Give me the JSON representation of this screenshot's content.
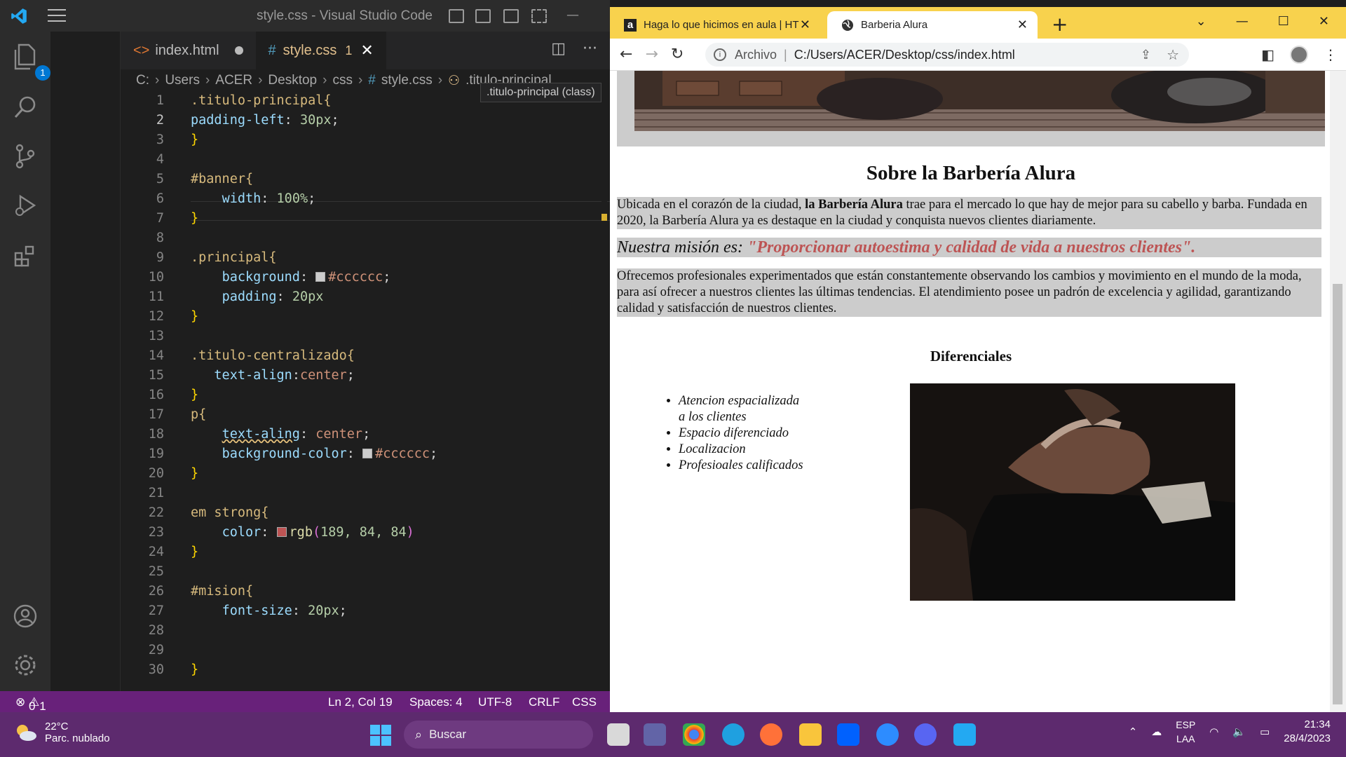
{
  "vscode": {
    "title": "style.css - Visual Studio Code",
    "source_control_badge": "1",
    "tabs": [
      {
        "label": "index.html",
        "modified": true
      },
      {
        "label": "style.css",
        "problems": "1"
      }
    ],
    "breadcrumb": [
      "C:",
      "Users",
      "ACER",
      "Desktop",
      "css",
      "style.css",
      ".titulo-principal"
    ],
    "tooltip": ".titulo-principal (class)",
    "line_numbers": [
      "1",
      "2",
      "3",
      "4",
      "5",
      "6",
      "7",
      "8",
      "9",
      "10",
      "11",
      "12",
      "13",
      "14",
      "15",
      "16",
      "17",
      "18",
      "19",
      "20",
      "21",
      "22",
      "23",
      "24",
      "25",
      "26",
      "27",
      "28",
      "29",
      "30"
    ],
    "code": {
      "l1": ".titulo-principal{",
      "l2_prop": "padding-left",
      "l2_val": "30px",
      "l5": "#banner{",
      "l6_prop": "width",
      "l6_val": "100%",
      "l9": ".principal{",
      "l10_prop": "background",
      "l10_val": "#cccccc",
      "l11_prop": "padding",
      "l11_val": "20px",
      "l14": ".titulo-centralizado{",
      "l15_prop": "text-align",
      "l15_val": "center",
      "l17": "p{",
      "l18_prop": "text-aling",
      "l18_val": "center",
      "l19_prop": "background-color",
      "l19_val": "#cccccc",
      "l22": "em strong{",
      "l23_prop": "color",
      "l23_fn": "rgb",
      "l23_args": "189, 84, 84",
      "l26": "#mision{",
      "l27_prop": "font-size",
      "l27_val": "20px",
      "open": "{",
      "close": "}"
    },
    "status": {
      "errors": "0",
      "warnings": "1",
      "position": "Ln 2, Col 19",
      "spaces": "Spaces: 4",
      "encoding": "UTF-8",
      "eol": "CRLF",
      "language": "CSS"
    },
    "colors": {
      "statusbar": "#68217a",
      "swatch_gray": "#cccccc",
      "swatch_red": "#bd5454"
    }
  },
  "chrome": {
    "tabs": [
      {
        "title": "Haga lo que hicimos en aula | HT"
      },
      {
        "title": "Barberia Alura"
      }
    ],
    "address_label": "Archivo",
    "address": "C:/Users/ACER/Desktop/css/index.html",
    "accent": "#f8d24d"
  },
  "page": {
    "heading": "Sobre la Barbería Alura",
    "p1_pre": "Ubicada en el corazón de la ciudad, ",
    "p1_strong": "la Barbería Alura",
    "p1_post": " trae para el mercado lo que hay de mejor para su cabello y barba. Fundada en 2020, la Barbería Alura ya es destaque en la ciudad y conquista nuevos clientes diariamente.",
    "mision_em": "Nuestra misión es: ",
    "mision_strong": "\"Proporcionar autoestima y calidad de vida a nuestros clientes\".",
    "p3": "Ofrecemos profesionales experimentados que están constantemente observando los cambios y movimiento en el mundo de la moda, para así ofrecer a nuestros clientes las últimas tendencias. El atendimiento posee un padrón de excelencia y agilidad, garantizando calidad y satisfacción de nuestros clientes.",
    "diferenciales_title": "Diferenciales",
    "diferenciales": [
      "Atencion espacializada a los clientes",
      "Espacio diferenciado",
      "Localizacion",
      "Profesioales calificados"
    ]
  },
  "taskbar": {
    "temperature": "22°C",
    "weather": "Parc. nublado",
    "search_placeholder": "Buscar",
    "lang1": "ESP",
    "lang2": "LAA",
    "time": "21:34",
    "date": "28/4/2023"
  }
}
